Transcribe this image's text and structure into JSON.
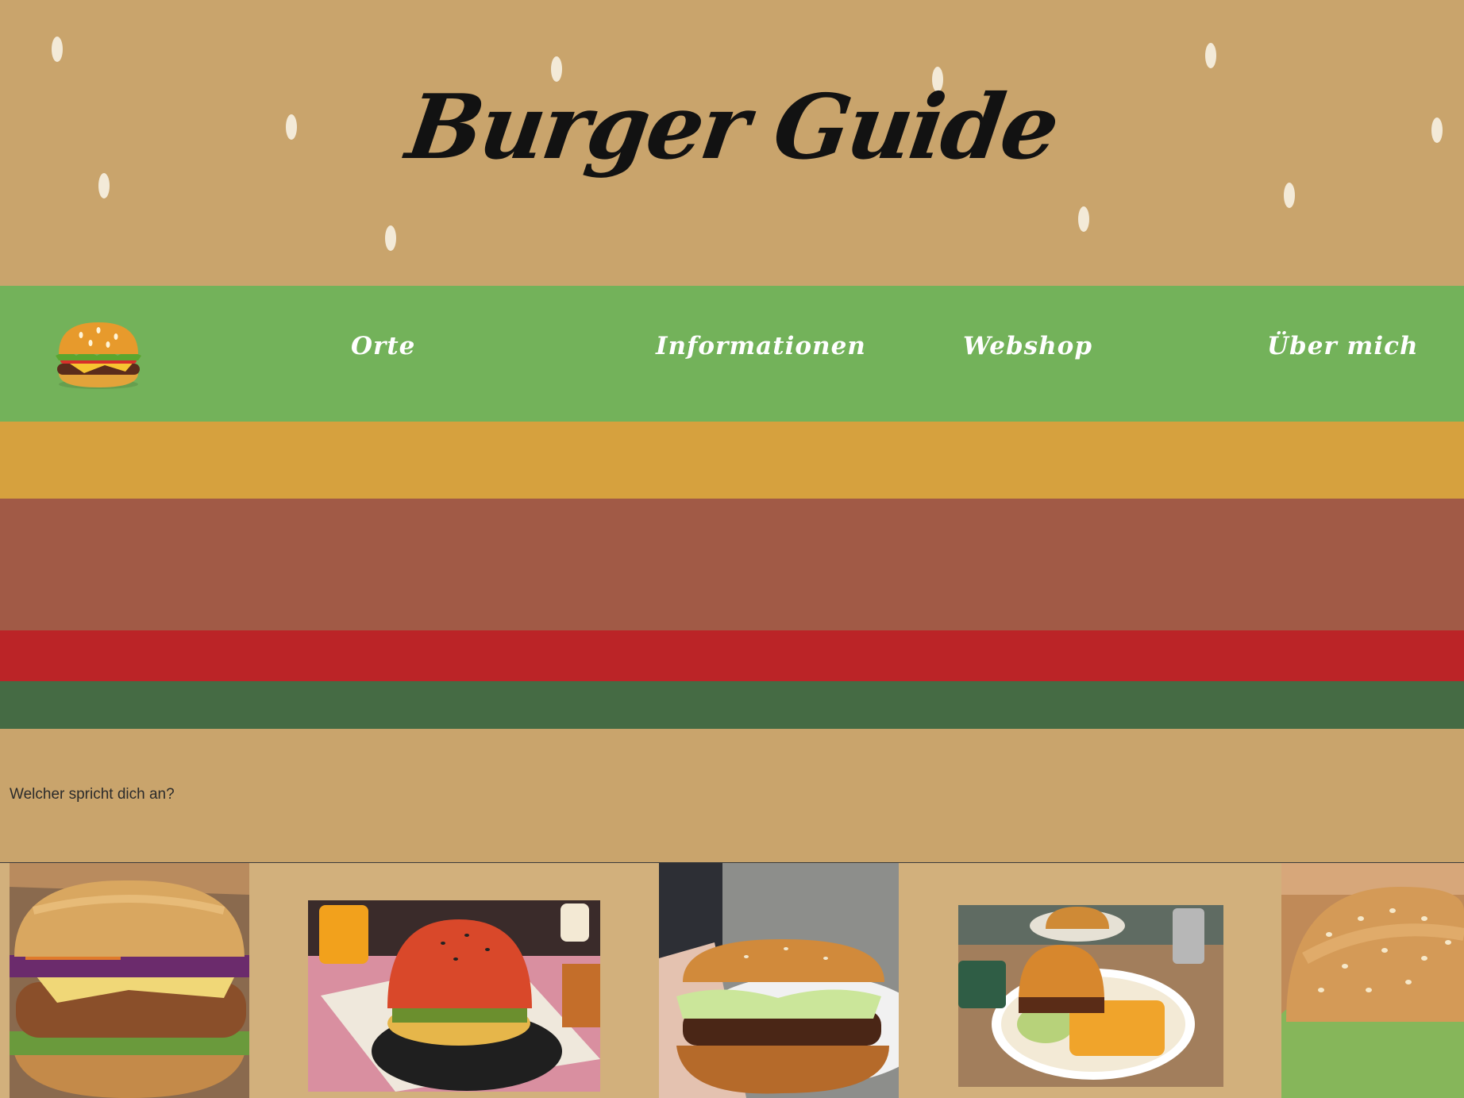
{
  "header": {
    "title": "Burger Guide"
  },
  "nav": {
    "logo_icon": "burger-icon",
    "items": [
      {
        "label": "Orte"
      },
      {
        "label": "Informationen"
      },
      {
        "label": "Webshop"
      },
      {
        "label": "Über mich"
      }
    ]
  },
  "intro": {
    "text": "Welcher spricht dich an?"
  },
  "gallery": {
    "photos": [
      {
        "subject": "veggie-burger-photo"
      },
      {
        "subject": "red-bun-burger-photo"
      },
      {
        "subject": "hand-held-burger-photo"
      },
      {
        "subject": "burger-with-waffle-fries-photo"
      },
      {
        "subject": "sesame-bun-burger-photo"
      }
    ]
  },
  "colors": {
    "bun": "#c9a46c",
    "sesame": "#f3ead8",
    "lettuce_nav": "#73b25a",
    "cheese": "#d6a13e",
    "patty": "#a15a46",
    "tomato": "#bb2427",
    "lettuce_dark": "#456b44",
    "gallery_bg": "#d2b07c"
  }
}
